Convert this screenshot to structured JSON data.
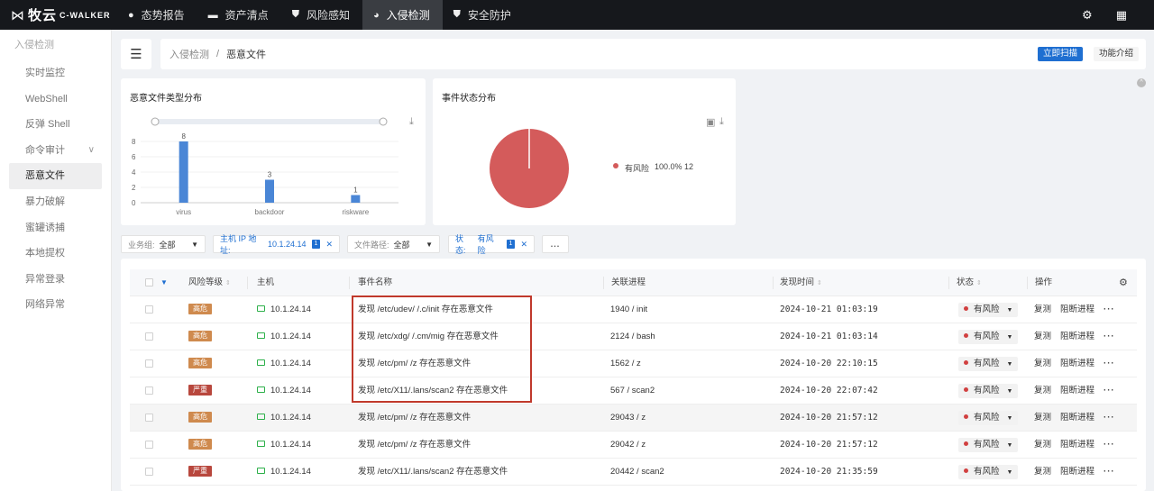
{
  "app": {
    "logo_cn": "牧云",
    "logo_en": "C-WALKER"
  },
  "nav": [
    {
      "label": "态势报告",
      "icon": "dashboard-icon"
    },
    {
      "label": "资产清点",
      "icon": "briefcase-icon"
    },
    {
      "label": "风险感知",
      "icon": "shield-icon"
    },
    {
      "label": "入侵检测",
      "icon": "radar-icon",
      "active": true
    },
    {
      "label": "安全防护",
      "icon": "shield-check-icon"
    }
  ],
  "sidebar": {
    "title": "入侵检测",
    "items": [
      {
        "label": "实时监控"
      },
      {
        "label": "WebShell"
      },
      {
        "label": "反弹 Shell"
      },
      {
        "label": "命令审计"
      },
      {
        "label": "恶意文件",
        "active": true
      },
      {
        "label": "暴力破解"
      },
      {
        "label": "蜜罐诱捕"
      },
      {
        "label": "本地提权"
      },
      {
        "label": "异常登录"
      },
      {
        "label": "网络异常"
      }
    ]
  },
  "breadcrumb": {
    "parent": "入侵检测",
    "sep": "/",
    "current": "恶意文件"
  },
  "actions": {
    "scan": "立即扫描",
    "intro": "功能介绍"
  },
  "charts": {
    "type_title": "恶意文件类型分布",
    "status_title": "事件状态分布",
    "pie_legend": "有风险",
    "pie_legend_value": "100.0% 12"
  },
  "chart_data": [
    {
      "type": "bar",
      "categories": [
        "virus",
        "backdoor",
        "riskware"
      ],
      "values": [
        8,
        3,
        1
      ],
      "yticks": [
        "0",
        "2",
        "4",
        "6",
        "8"
      ],
      "ylim": [
        0,
        8
      ],
      "color": "#4a86d6"
    },
    {
      "type": "pie",
      "labels": [
        "有风险"
      ],
      "values": [
        12
      ],
      "percent": [
        "100.0%"
      ],
      "color": "#d45b5b"
    }
  ],
  "filters": {
    "biz_key": "业务组:",
    "biz_val": "全部",
    "ip_key": "主机 IP 地址:",
    "ip_val": "10.1.24.14",
    "path_key": "文件路径:",
    "path_val": "全部",
    "status_key": "状态:",
    "status_val": "有风险",
    "tag": "1",
    "more": "..."
  },
  "table": {
    "headers": {
      "level": "风险等级",
      "host": "主机",
      "event": "事件名称",
      "process": "关联进程",
      "time": "发现时间",
      "status": "状态",
      "ops": "操作"
    },
    "rows": [
      {
        "level": "高危",
        "color": "#cf8a4e",
        "host": "10.1.24.14",
        "event": "发现 /etc/udev/ /.c/init 存在恶意文件",
        "process": "1940 / init",
        "time": "2024-10-21 01:03:19",
        "status": "有风险"
      },
      {
        "level": "高危",
        "color": "#cf8a4e",
        "host": "10.1.24.14",
        "event": "发现 /etc/xdg/ /.cm/mig 存在恶意文件",
        "process": "2124 / bash",
        "time": "2024-10-21 01:03:14",
        "status": "有风险"
      },
      {
        "level": "高危",
        "color": "#cf8a4e",
        "host": "10.1.24.14",
        "event": "发现 /etc/pm/ /z 存在恶意文件",
        "process": "1562 / z",
        "time": "2024-10-20 22:10:15",
        "status": "有风险"
      },
      {
        "level": "严重",
        "color": "#b8473d",
        "host": "10.1.24.14",
        "event": "发现 /etc/X11/.lans/scan2 存在恶意文件",
        "process": "567 / scan2",
        "time": "2024-10-20 22:07:42",
        "status": "有风险"
      },
      {
        "level": "高危",
        "color": "#cf8a4e",
        "host": "10.1.24.14",
        "event": "发现 /etc/pm/ /z 存在恶意文件",
        "process": "29043 / z",
        "time": "2024-10-20 21:57:12",
        "status": "有风险"
      },
      {
        "level": "高危",
        "color": "#cf8a4e",
        "host": "10.1.24.14",
        "event": "发现 /etc/pm/ /z 存在恶意文件",
        "process": "29042 / z",
        "time": "2024-10-20 21:57:12",
        "status": "有风险"
      },
      {
        "level": "严重",
        "color": "#b8473d",
        "host": "10.1.24.14",
        "event": "发现 /etc/X11/.lans/scan2 存在恶意文件",
        "process": "20442 / scan2",
        "time": "2024-10-20 21:35:59",
        "status": "有风险"
      }
    ],
    "op_review": "复测",
    "op_block": "阻断进程",
    "op_more": "···"
  }
}
